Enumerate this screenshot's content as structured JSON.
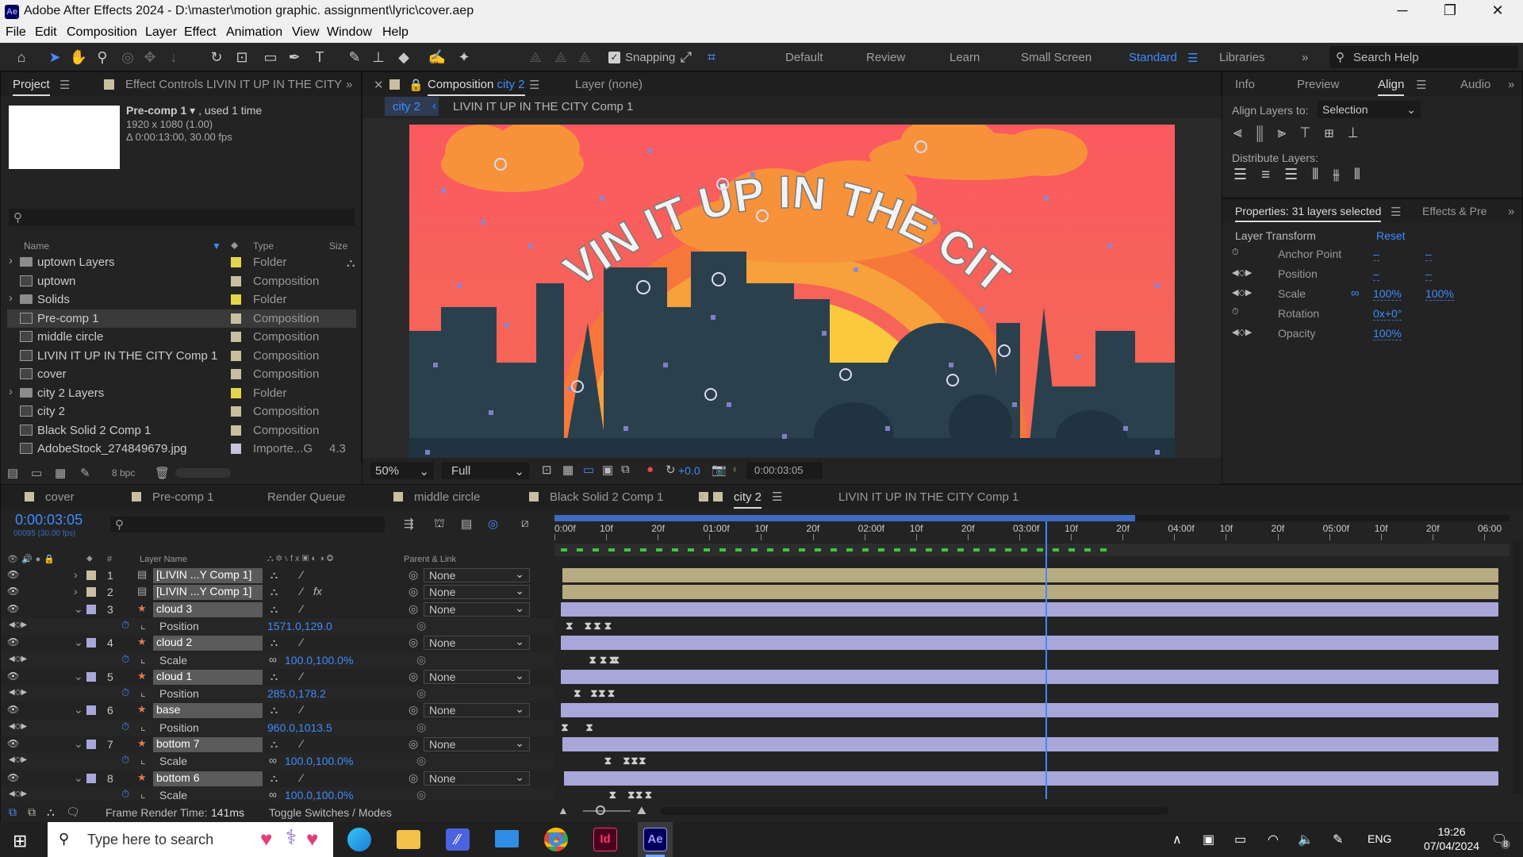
{
  "window": {
    "title": "Adobe After Effects 2024 - D:\\master\\motion graphic. assignment\\lyric\\cover.aep",
    "logo": "Ae"
  },
  "menu": [
    "File",
    "Edit",
    "Composition",
    "Layer",
    "Effect",
    "Animation",
    "View",
    "Window",
    "Help"
  ],
  "toolbar": {
    "snapping": "Snapping",
    "workspaces": [
      "Default",
      "Review",
      "Learn",
      "Small Screen",
      "Standard",
      "Libraries"
    ],
    "active_workspace": "Standard",
    "search_help": "Search Help"
  },
  "project": {
    "tabs": [
      "Project",
      "Effect Controls LIVIN IT UP IN THE CITY"
    ],
    "selected_name": "Pre-comp 1",
    "used": ", used 1 time",
    "size": "1920 x 1080 (1.00)",
    "duration": "Δ 0:00:13:00, 30.00 fps",
    "col_name": "Name",
    "col_type": "Type",
    "col_size": "Size",
    "items": [
      {
        "name": "uptown Layers",
        "type": "Folder",
        "kind": "folder",
        "color": "#e4d64a",
        "size": ""
      },
      {
        "name": "uptown",
        "type": "Composition",
        "kind": "comp",
        "color": "#c9bfa0",
        "size": ""
      },
      {
        "name": "Solids",
        "type": "Folder",
        "kind": "folder",
        "color": "#e4d64a",
        "size": ""
      },
      {
        "name": "Pre-comp 1",
        "type": "Composition",
        "kind": "comp",
        "color": "#c9bfa0",
        "size": ""
      },
      {
        "name": "middle circle",
        "type": "Composition",
        "kind": "comp",
        "color": "#c9bfa0",
        "size": ""
      },
      {
        "name": "LIVIN IT UP IN THE CITY Comp 1",
        "type": "Composition",
        "kind": "comp",
        "color": "#c9bfa0",
        "size": ""
      },
      {
        "name": "cover",
        "type": "Composition",
        "kind": "comp",
        "color": "#c9bfa0",
        "size": ""
      },
      {
        "name": "city 2 Layers",
        "type": "Folder",
        "kind": "folder",
        "color": "#e4d64a",
        "size": ""
      },
      {
        "name": "city 2",
        "type": "Composition",
        "kind": "comp",
        "color": "#c9bfa0",
        "size": ""
      },
      {
        "name": "Black Solid 2 Comp 1",
        "type": "Composition",
        "kind": "comp",
        "color": "#c9bfa0",
        "size": ""
      },
      {
        "name": "AdobeStock_274849679.jpg",
        "type": "Importe...G",
        "kind": "image",
        "color": "#c4c4e0",
        "size": "4.3"
      }
    ],
    "bpc": "8 bpc"
  },
  "composition": {
    "tab_label": "Composition",
    "tab_name": "city 2",
    "layer_tab": "Layer (none)",
    "breadcrumb_active": "city 2",
    "breadcrumb_next": "LIVIN IT UP IN THE CITY Comp 1",
    "artwork_text": "LIVIN IT UP IN THE CITY",
    "zoom": "50%",
    "resolution": "Full",
    "exposure": "+0.0",
    "timecode": "0:00:03:05"
  },
  "align": {
    "tabs": [
      "Info",
      "Preview",
      "Align",
      "Audio"
    ],
    "active_tab": "Align",
    "align_to_label": "Align Layers to:",
    "align_to_value": "Selection",
    "distribute_label": "Distribute Layers:"
  },
  "properties": {
    "title": "Properties: 31 layers selected",
    "effects_tab": "Effects & Pre",
    "section": "Layer Transform",
    "reset": "Reset",
    "rows": [
      {
        "label": "Anchor Point",
        "v1": "–",
        "v2": "–"
      },
      {
        "label": "Position",
        "v1": "–",
        "v2": "–"
      },
      {
        "label": "Scale",
        "v1": "100%",
        "v2": "100%"
      },
      {
        "label": "Rotation",
        "v1": "0x+0°",
        "v2": ""
      },
      {
        "label": "Opacity",
        "v1": "100%",
        "v2": ""
      }
    ]
  },
  "timeline": {
    "tabs": [
      "cover",
      "Pre-comp 1",
      "Render Queue",
      "middle circle",
      "Black Solid 2 Comp 1",
      "city 2",
      "LIVIN IT UP IN THE CITY Comp 1"
    ],
    "active_tab": "city 2",
    "timecode": "0:00:03:05",
    "frame_info": "00095 (30.00 fps)",
    "col_layer_name": "Layer Name",
    "col_parent": "Parent & Link",
    "ruler": [
      "0:00f",
      "10f",
      "20f",
      "01:00f",
      "10f",
      "20f",
      "02:00f",
      "10f",
      "20f",
      "03:00f",
      "10f",
      "20f",
      "04:00f",
      "10f",
      "20f",
      "05:00f",
      "10f",
      "20f",
      "06:00"
    ],
    "current_time_seconds": 3.17,
    "rows": [
      {
        "kind": "layer",
        "num": "1",
        "name": "[LIVIN ...Y Comp 1]",
        "parent": "None",
        "bar": "tan",
        "start_s": 0.1,
        "fx": false
      },
      {
        "kind": "layer",
        "num": "2",
        "name": "[LIVIN ...Y Comp 1]",
        "parent": "None",
        "bar": "tan",
        "start_s": 0.1,
        "fx": true
      },
      {
        "kind": "layer",
        "num": "3",
        "name": "cloud 3",
        "parent": "None",
        "bar": "purple",
        "start_s": 0.0,
        "fx": false
      },
      {
        "kind": "prop",
        "name": "Position",
        "value": "1571.0,129.0",
        "keys_s": [
          0.1,
          0.5,
          0.7,
          0.93
        ]
      },
      {
        "kind": "layer",
        "num": "4",
        "name": "cloud 2",
        "parent": "None",
        "bar": "purple",
        "start_s": 0.0,
        "fx": false
      },
      {
        "kind": "prop",
        "name": "Scale",
        "value": "100.0,100.0%",
        "keys_s": [
          0.6,
          0.83,
          1.03,
          1.1
        ]
      },
      {
        "kind": "layer",
        "num": "5",
        "name": "cloud 1",
        "parent": "None",
        "bar": "purple",
        "start_s": 0.0,
        "fx": false
      },
      {
        "kind": "prop",
        "name": "Position",
        "value": "285.0,178.2",
        "keys_s": [
          0.27,
          0.63,
          0.8,
          1.0
        ]
      },
      {
        "kind": "layer",
        "num": "6",
        "name": "base",
        "parent": "None",
        "bar": "purple",
        "start_s": 0.0,
        "fx": false
      },
      {
        "kind": "prop",
        "name": "Position",
        "value": "960.0,1013.5",
        "keys_s": [
          0.0,
          0.53
        ]
      },
      {
        "kind": "layer",
        "num": "7",
        "name": "bottom 7",
        "parent": "None",
        "bar": "purple",
        "start_s": 0.1,
        "fx": false
      },
      {
        "kind": "prop",
        "name": "Scale",
        "value": "100.0,100.0%",
        "keys_s": [
          0.93,
          1.33,
          1.5,
          1.67
        ]
      },
      {
        "kind": "layer",
        "num": "8",
        "name": "bottom 6",
        "parent": "None",
        "bar": "purple",
        "start_s": 0.2,
        "fx": false
      },
      {
        "kind": "prop",
        "name": "Scale",
        "value": "100.0,100.0%",
        "keys_s": [
          1.03,
          1.43,
          1.6,
          1.8
        ]
      }
    ],
    "footer_render": "Frame Render Time:",
    "footer_ms": "141ms",
    "footer_toggle": "Toggle Switches / Modes"
  },
  "taskbar": {
    "search_placeholder": "Type here to search",
    "lang": "ENG",
    "time": "19:26",
    "date": "07/04/2024",
    "notifications": "8"
  }
}
